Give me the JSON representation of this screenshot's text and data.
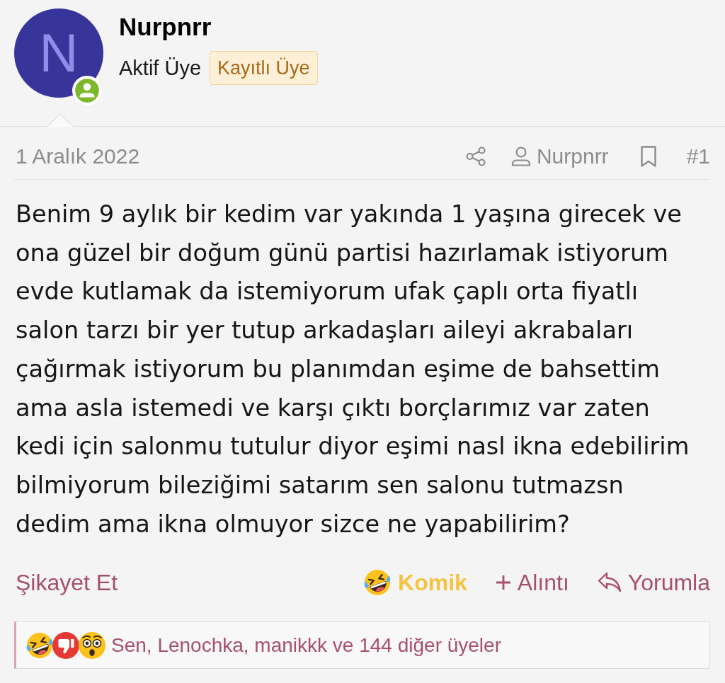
{
  "author": {
    "name": "Nurpnrr",
    "avatar_letter": "N",
    "online": true,
    "title": "Aktif Üye",
    "badge": "Kayıtlı Üye"
  },
  "post_meta": {
    "date": "1 Aralık 2022",
    "author_link": "Nurpnrr",
    "post_number": "#1"
  },
  "body": "Benim 9 aylık bir kedim var yakında 1 yaşına girecek ve ona güzel bir doğum günü partisi hazırlamak istiyorum evde kutlamak da istemiyorum ufak çaplı orta fiyatlı salon tarzı bir yer tutup arkadaşları aileyi akrabaları çağırmak istiyorum bu planımdan eşime de bahsettim ama asla istemedi ve karşı çıktı borçlarımız var zaten kedi için salonmu tutulur diyor eşimi nasl ikna edebilirim bilmiyorum bileziğimi satarım sen salonu tutmazsn dedim ama ikna olmuyor sizce ne yapabilirim?",
  "actions": {
    "report": "Şikayet Et",
    "reaction": {
      "kind": "laugh",
      "label": "Komik",
      "selected": true
    },
    "quote": "Alıntı",
    "reply": "Yorumla"
  },
  "reactions_summary": {
    "reactions": [
      {
        "kind": "laugh"
      },
      {
        "kind": "dislike"
      },
      {
        "kind": "wow"
      }
    ],
    "text": "Sen, Lenochka, manikkk ve 144 diğer üyeler"
  }
}
